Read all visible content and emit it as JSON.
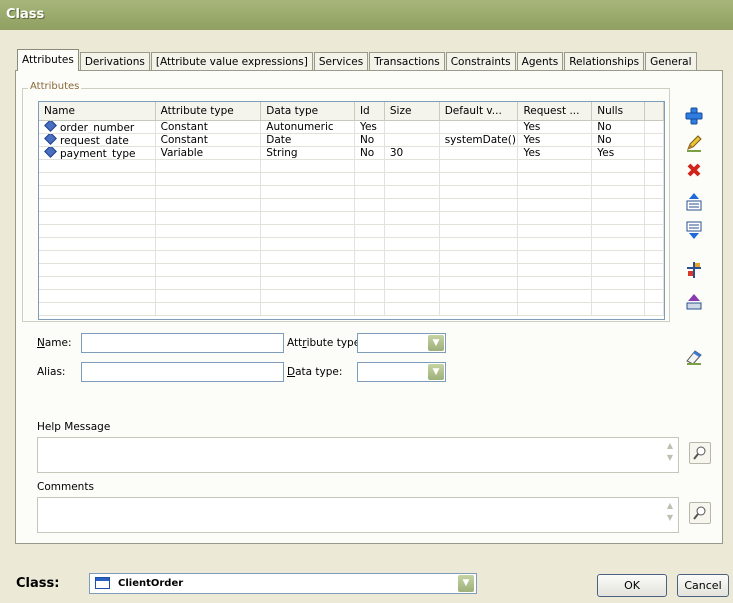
{
  "window": {
    "title": "Class"
  },
  "tabs": [
    "Attributes",
    "Derivations",
    "[Attribute value expressions]",
    "Services",
    "Transactions",
    "Constraints",
    "Agents",
    "Relationships",
    "General"
  ],
  "attributes_group": {
    "label": "Attributes"
  },
  "grid": {
    "columns": [
      "Name",
      "Attribute type",
      "Data type",
      "Id",
      "Size",
      "Default v...",
      "Request ...",
      "Nulls",
      ""
    ],
    "rows": [
      [
        "order_number",
        "Constant",
        "Autonumeric",
        "Yes",
        "",
        "",
        "Yes",
        "No",
        ""
      ],
      [
        "request_date",
        "Constant",
        "Date",
        "No",
        "",
        "systemDate()",
        "Yes",
        "No",
        ""
      ],
      [
        "payment_type",
        "Variable",
        "String",
        "No",
        "30",
        "",
        "Yes",
        "Yes",
        ""
      ]
    ],
    "empty_rows": 12
  },
  "form": {
    "name_label": "Name:",
    "name_accel": "N",
    "name_rest": "ame:",
    "name_value": "",
    "alias_label": "Alias:",
    "alias_value": "",
    "attr_type_pre": "Att",
    "attr_type_accel": "r",
    "attr_type_rest": "ibute type:",
    "attr_type_value": "",
    "data_type_accel": "D",
    "data_type_rest": "ata type:",
    "data_type_value": "",
    "help_label": "Help Message",
    "help_value": "",
    "comments_label": "Comments",
    "comments_value": ""
  },
  "footer": {
    "class_label": "Class:",
    "class_value": "ClientOrder",
    "ok_label": "OK",
    "cancel_label": "Cancel"
  },
  "icons": {
    "add": "plus-icon",
    "edit": "pencil-icon",
    "delete": "red-x-icon",
    "move_up": "move-up-icon",
    "move_down": "move-down-icon",
    "properties": "properties-icon",
    "export": "export-icon",
    "eraser": "eraser-icon",
    "zoom": "magnifier-icon"
  },
  "colors": {
    "titlebar": "#9aab6c",
    "accent_border": "#7f9db9",
    "background": "#ecead7"
  }
}
